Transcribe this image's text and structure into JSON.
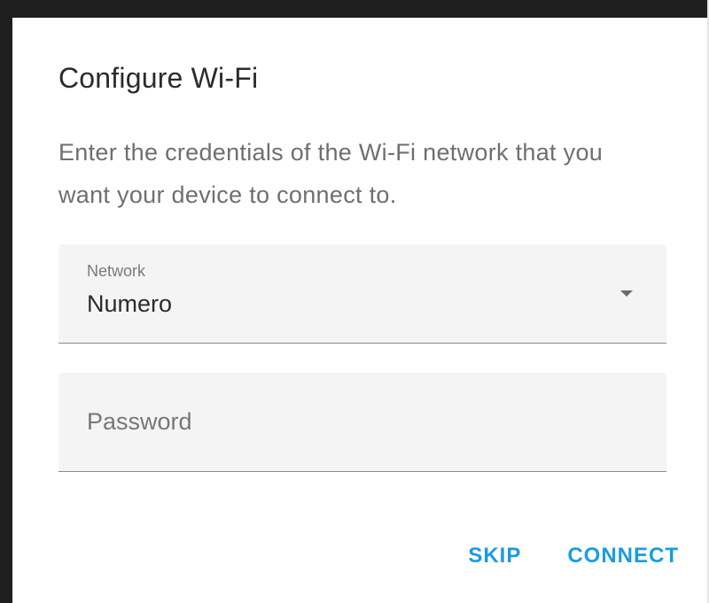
{
  "dialog": {
    "title": "Configure Wi-Fi",
    "description": "Enter the credentials of the Wi-Fi network that you want your device to connect to.",
    "network_field": {
      "label": "Network",
      "value": "Numero",
      "icon": "chevron-down-icon"
    },
    "password_field": {
      "placeholder": "Password",
      "value": ""
    },
    "actions": {
      "skip_label": "SKIP",
      "connect_label": "CONNECT"
    }
  },
  "colors": {
    "accent": "#1a9ce0",
    "field_background": "#f4f4f4",
    "title_text": "#2b2b2b",
    "description_text": "#6f6f6f"
  }
}
